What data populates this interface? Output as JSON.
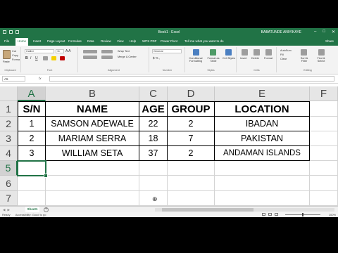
{
  "window": {
    "title": "Book1 - Excel",
    "user": "BABATUNDE ANIYIKAYE",
    "controls": [
      "–",
      "□",
      "✕"
    ]
  },
  "tabs": [
    {
      "label": "File",
      "active": false
    },
    {
      "label": "Home",
      "active": true
    },
    {
      "label": "Insert",
      "active": false
    },
    {
      "label": "Page Layout",
      "active": false
    },
    {
      "label": "Formulas",
      "active": false
    },
    {
      "label": "Data",
      "active": false
    },
    {
      "label": "Review",
      "active": false
    },
    {
      "label": "View",
      "active": false
    },
    {
      "label": "Help",
      "active": false
    },
    {
      "label": "WPS PDF",
      "active": false
    },
    {
      "label": "Power Pivot",
      "active": false
    }
  ],
  "tell_me": "Tell me what you want to do",
  "share": "Share",
  "ribbon": {
    "paste": "Paste",
    "cut": "Cut",
    "copy": "Copy",
    "format_painter": "Format Painter",
    "clipboard": "Clipboard",
    "font_name": "Calibri",
    "font_size": "11",
    "font_style_buttons": [
      "B",
      "I",
      "U"
    ],
    "font": "Font",
    "wrap_text": "Wrap Text",
    "merge_center": "Merge & Center",
    "alignment": "Alignment",
    "number_format": "General",
    "number": "Number",
    "conditional_formatting": "Conditional Formatting",
    "format_as_table": "Format as Table",
    "cell_styles": "Cell Styles",
    "styles": "Styles",
    "insert": "Insert",
    "delete": "Delete",
    "format": "Format",
    "cells": "Cells",
    "autosum": "AutoSum",
    "fill": "Fill",
    "clear": "Clear",
    "sort_filter": "Sort & Filter",
    "find_select": "Find & Select",
    "editing": "Editing"
  },
  "formula_bar": {
    "name_box": "A5",
    "fx": "fx",
    "formula": ""
  },
  "sheet": {
    "columns": [
      "A",
      "B",
      "C",
      "D",
      "E",
      "F"
    ],
    "rows": [
      "1",
      "2",
      "3",
      "4",
      "5",
      "6",
      "7"
    ],
    "selected_column": "A",
    "selected_row": "5",
    "header": [
      "S/N",
      "NAME",
      "AGE",
      "GROUP",
      "LOCATION"
    ],
    "data": [
      [
        "1",
        "SAMSON ADEWALE",
        "22",
        "2",
        "IBADAN"
      ],
      [
        "2",
        "MARIAM SERRA",
        "18",
        "7",
        "PAKISTAN"
      ],
      [
        "3",
        "WILLIAM SETA",
        "37",
        "2",
        "ANDAMAN ISLANDS"
      ]
    ]
  },
  "sheet_tabs": [
    {
      "label": "Sheet1",
      "active": true
    }
  ],
  "status": {
    "ready": "Ready",
    "accessibility": "Accessibility: Good to go",
    "zoom": "100%"
  }
}
